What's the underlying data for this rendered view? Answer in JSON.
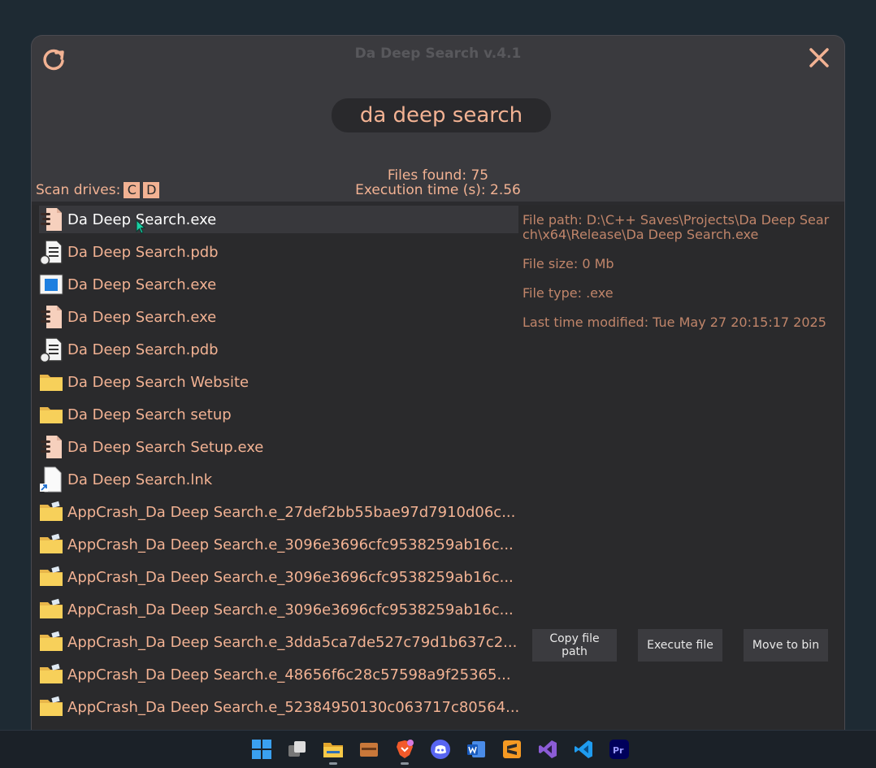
{
  "window": {
    "title": "Da Deep Search v.4.1"
  },
  "search": {
    "value": "da deep search"
  },
  "scan": {
    "label": "Scan drives:",
    "drives": [
      "C",
      "D"
    ]
  },
  "stats": {
    "files_found": "Files found: 75",
    "execution_time": "Execution time (s): 2.56"
  },
  "files": [
    {
      "name": "Da Deep Search.exe",
      "icon": "exe-setup-icon"
    },
    {
      "name": "Da Deep Search.pdb",
      "icon": "pdb-file-icon"
    },
    {
      "name": "Da Deep Search.exe",
      "icon": "app-window-icon"
    },
    {
      "name": "Da Deep Search.exe",
      "icon": "exe-setup-icon"
    },
    {
      "name": "Da Deep Search.pdb",
      "icon": "pdb-file-icon"
    },
    {
      "name": "Da Deep Search Website",
      "icon": "folder-icon"
    },
    {
      "name": "Da Deep Search setup",
      "icon": "folder-icon"
    },
    {
      "name": "Da Deep Search Setup.exe",
      "icon": "exe-setup-icon"
    },
    {
      "name": "Da Deep Search.lnk",
      "icon": "shortcut-file-icon"
    },
    {
      "name": "AppCrash_Da Deep Search.e_27def2bb55bae97d7910d06c...",
      "icon": "crash-folder-icon"
    },
    {
      "name": "AppCrash_Da Deep Search.e_3096e3696cfc9538259ab16c...",
      "icon": "crash-folder-icon"
    },
    {
      "name": "AppCrash_Da Deep Search.e_3096e3696cfc9538259ab16c...",
      "icon": "crash-folder-icon"
    },
    {
      "name": "AppCrash_Da Deep Search.e_3096e3696cfc9538259ab16c...",
      "icon": "crash-folder-icon"
    },
    {
      "name": "AppCrash_Da Deep Search.e_3dda5ca7de527c79d1b637c2...",
      "icon": "crash-folder-icon"
    },
    {
      "name": "AppCrash_Da Deep Search.e_48656f6c28c57598a9f25365...",
      "icon": "crash-folder-icon"
    },
    {
      "name": "AppCrash_Da Deep Search.e_52384950130c063717c80564...",
      "icon": "crash-folder-icon"
    }
  ],
  "details": {
    "path": "File path: D:\\C++ Saves\\Projects\\Da Deep Search\\x64\\Release\\Da Deep Search.exe",
    "size": "File size: 0 Mb",
    "type": "File type: .exe",
    "modified": "Last time modified: Tue May 27 20:15:17 2025"
  },
  "buttons": {
    "copy": "Copy file path",
    "execute": "Execute file",
    "bin": "Move to bin"
  },
  "colors": {
    "accent": "#f2b293",
    "panel": "#2a2a2c",
    "window": "#3a3a3e"
  },
  "taskbar": [
    "windows-start-icon",
    "task-view-icon",
    "file-explorer-icon",
    "image-viewer-icon",
    "brave-browser-icon",
    "discord-icon",
    "word-icon",
    "sublime-text-icon",
    "visual-studio-icon",
    "vscode-icon",
    "premiere-pro-icon"
  ]
}
